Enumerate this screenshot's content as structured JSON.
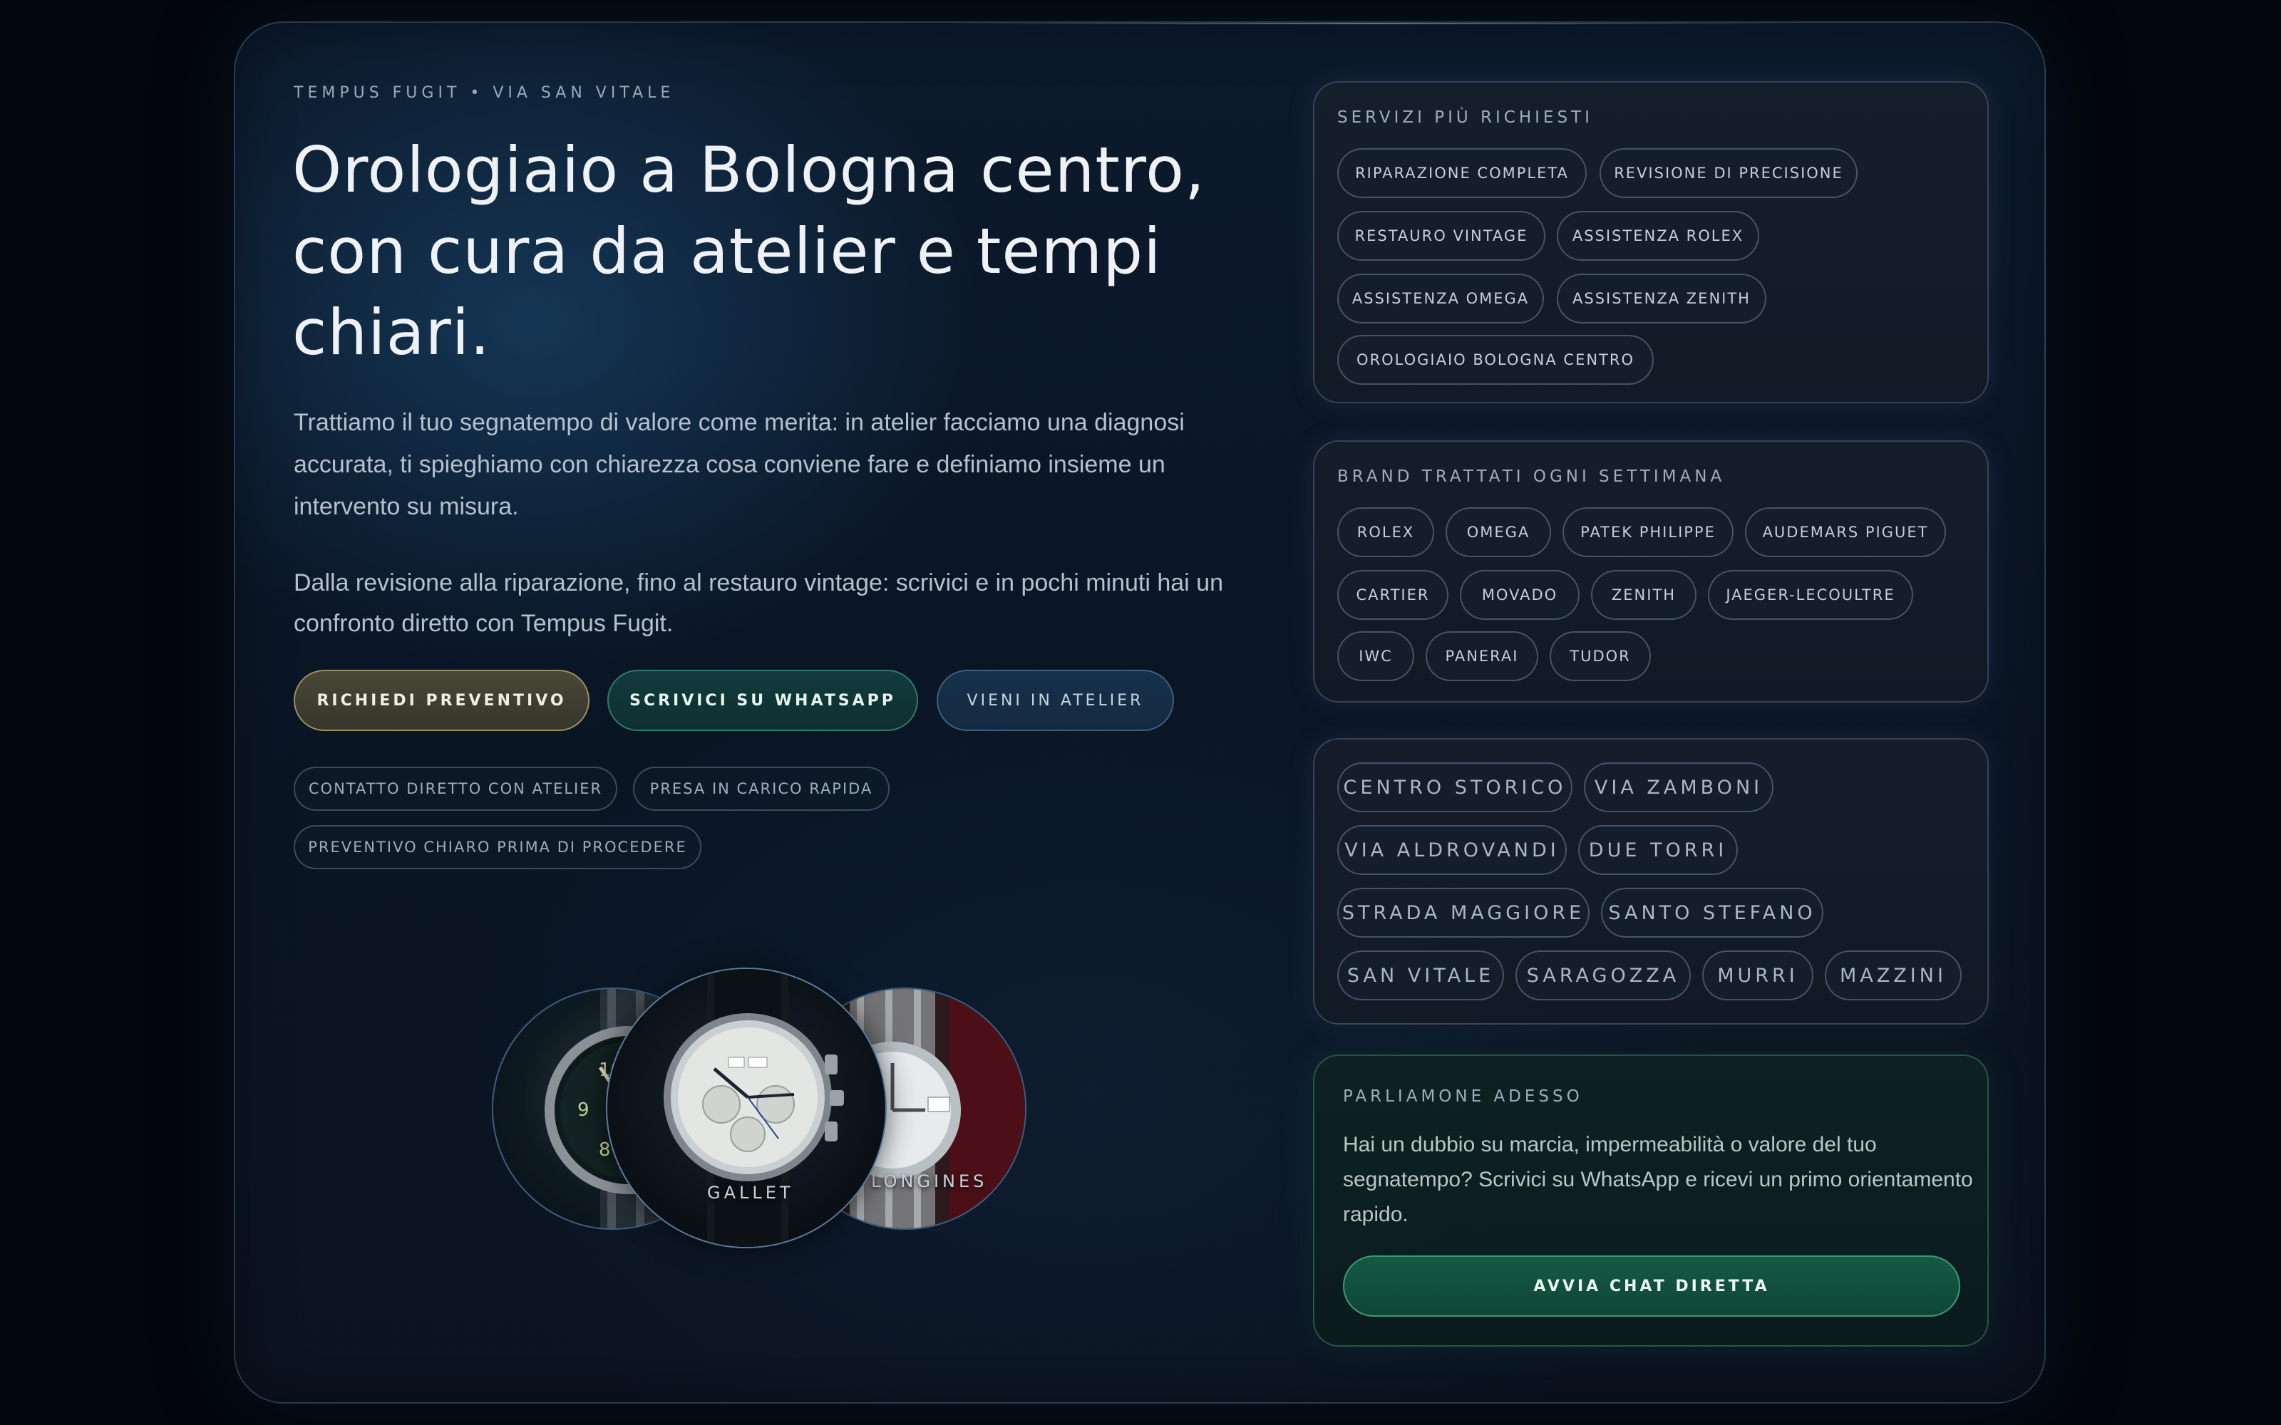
{
  "hero": {
    "eyebrow": "TEMPUS FUGIT • VIA SAN VITALE",
    "title_lines": [
      "Orologiaio a Bologna centro,",
      "con cura da atelier e tempi",
      "chiari."
    ],
    "lead_lines": [
      "Trattiamo il tuo segnatempo di valore come merita: in atelier facciamo una diagnosi",
      "accurata, ti spieghiamo con chiarezza cosa conviene fare e definiamo insieme un",
      "intervento su misura."
    ],
    "lead2_lines": [
      "Dalla revisione alla riparazione, fino al restauro vintage: scrivici e in pochi minuti hai un",
      "confronto diretto con Tempus Fugit."
    ],
    "cta_quote": "RICHIEDI PREVENTIVO",
    "cta_whatsapp": "SCRIVICI SU WHATSAPP",
    "cta_visit": "VIENI IN ATELIER",
    "trust": [
      "CONTATTO DIRETTO CON ATELIER",
      "PRESA IN CARICO RAPIDA",
      "PREVENTIVO CHIARO PRIMA DI PROCEDERE"
    ]
  },
  "watches": {
    "center_label": "GALLET",
    "right_label": "LONGINES"
  },
  "services": {
    "title": "SERVIZI PIÙ RICHIESTI",
    "items": [
      "RIPARAZIONE COMPLETA",
      "REVISIONE DI PRECISIONE",
      "RESTAURO VINTAGE",
      "ASSISTENZA ROLEX",
      "ASSISTENZA OMEGA",
      "ASSISTENZA ZENITH",
      "OROLOGIAIO BOLOGNA CENTRO"
    ]
  },
  "brands": {
    "title": "BRAND TRATTATI OGNI SETTIMANA",
    "items": [
      "ROLEX",
      "OMEGA",
      "PATEK PHILIPPE",
      "AUDEMARS PIGUET",
      "CARTIER",
      "MOVADO",
      "ZENITH",
      "JAEGER-LECOULTRE",
      "IWC",
      "PANERAI",
      "TUDOR"
    ]
  },
  "areas": {
    "items": [
      "CENTRO STORICO",
      "VIA ZAMBONI",
      "VIA ALDROVANDI",
      "DUE TORRI",
      "STRADA MAGGIORE",
      "SANTO STEFANO",
      "SAN VITALE",
      "SARAGOZZA",
      "MURRI",
      "MAZZINI"
    ]
  },
  "chat": {
    "title": "PARLIAMONE ADESSO",
    "text_lines": [
      "Hai un dubbio su marcia, impermeabilità o valore del tuo",
      "segnatempo? Scrivici su WhatsApp e ricevi un primo orientamento",
      "rapido."
    ],
    "button": "AVVIA CHAT DIRETTA"
  }
}
